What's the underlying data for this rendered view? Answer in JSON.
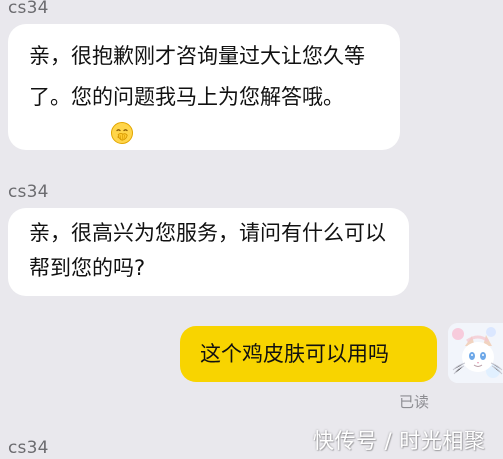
{
  "chat": {
    "messages": [
      {
        "sender": "cs34",
        "text": "亲，很抱歉刚才咨询量过大让您久等了。您的问题我马上为您解答哦。",
        "emoji": "face-with-hand-over-mouth-emoji"
      },
      {
        "sender": "cs34",
        "text": "亲，很高兴为您服务，请问有什么可以帮到您的吗?"
      },
      {
        "text": "这个鸡皮肤可以用吗",
        "status": "已读"
      },
      {
        "sender": "cs34"
      }
    ]
  },
  "watermark": {
    "text": "快传号 / 时光相聚"
  },
  "colors": {
    "background": "#e9e8ed",
    "incoming_bubble": "#ffffff",
    "outgoing_bubble": "#f8d400",
    "sender_text": "#6c6c70"
  },
  "icons": {
    "emoji": "face-with-hand-over-mouth-emoji",
    "avatar": "cat-avatar"
  }
}
